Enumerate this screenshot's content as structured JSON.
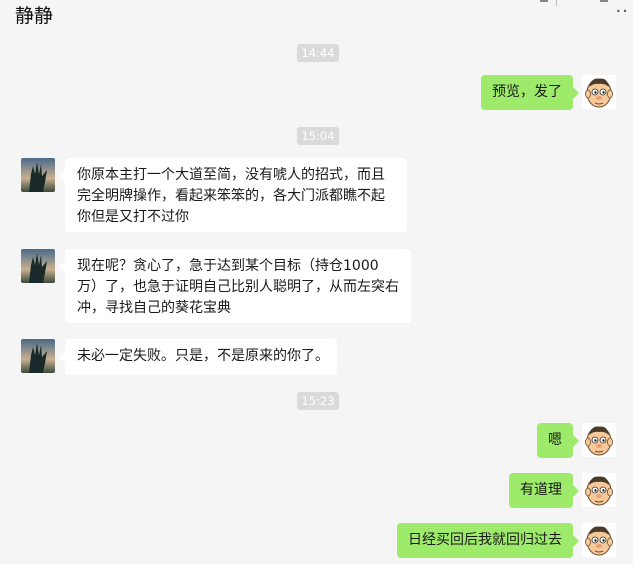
{
  "header": {
    "title": "静静",
    "more_label": ".."
  },
  "timestamps": [
    "14:44",
    "15:04",
    "15:23"
  ],
  "messages": {
    "m1": "预览，发了",
    "m2": "你原本主打一个大道至简，没有唬人的招式，而且完全明牌操作，看起来笨笨的，各大门派都瞧不起你但是又打不过你",
    "m3": "现在呢？贪心了，急于达到某个目标（持仓1000万）了，也急于证明自己比别人聪明了，从而左突右冲，寻找自己的葵花宝典",
    "m4": "未必一定失败。只是，不是原来的你了。",
    "m5": "嗯",
    "m6": "有道理",
    "m7": "日经买回后我就回归过去"
  },
  "colors": {
    "self_bubble": "#9eea6a",
    "other_bubble": "#ffffff",
    "background": "#f5f5f5",
    "timestamp_bg": "#dadada"
  },
  "icons": {
    "contact_avatar": "hand-ok-sunset-avatar",
    "self_avatar": "cartoon-man-avatar"
  }
}
